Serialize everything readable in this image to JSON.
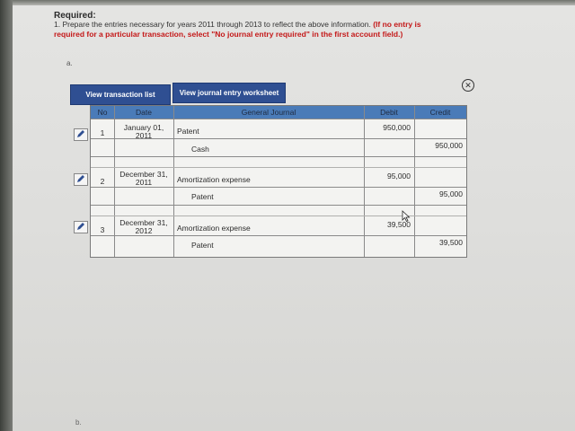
{
  "header": {
    "required_label": "Required:",
    "instruction_prefix": "1. Prepare the entries necessary for years 2011 through 2013 to reflect the above information.",
    "instruction_note": "(If no entry is required for a particular transaction, select \"No journal entry required\" in the first account field.)",
    "part_a": "a.",
    "part_b": "b."
  },
  "buttons": {
    "view_transaction_list": "View transaction list",
    "view_journal_worksheet": "View journal entry worksheet"
  },
  "journal": {
    "columns": {
      "no": "No",
      "date": "Date",
      "general_journal": "General Journal",
      "debit": "Debit",
      "credit": "Credit"
    },
    "entries": [
      {
        "no": "1",
        "date": "January 01, 2011",
        "debit_account": "Patent",
        "debit": "950,000",
        "credit_account": "Cash",
        "credit": "950,000"
      },
      {
        "no": "2",
        "date": "December 31, 2011",
        "debit_account": "Amortization expense",
        "debit": "95,000",
        "credit_account": "Patent",
        "credit": "95,000"
      },
      {
        "no": "3",
        "date": "December 31, 2012",
        "debit_account": "Amortization expense",
        "debit": "39,500",
        "credit_account": "Patent",
        "credit": "39,500"
      }
    ]
  },
  "icons": {
    "close": "close-circle-icon",
    "edit": "pencil-icon",
    "cursor": "mouse-pointer-icon"
  }
}
